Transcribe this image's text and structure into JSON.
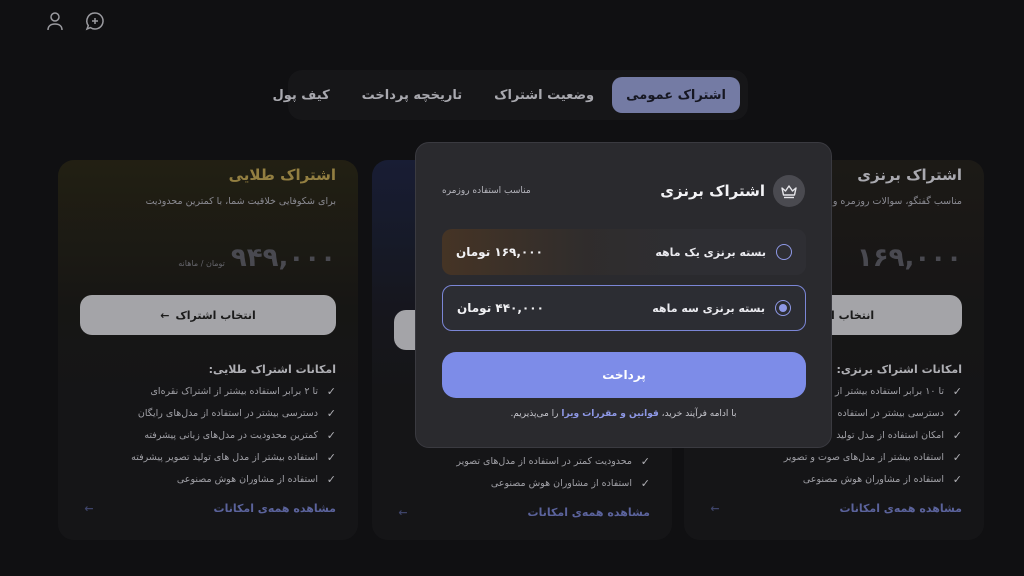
{
  "topbar": {
    "icons": [
      "user-icon",
      "chat-add-icon"
    ]
  },
  "tabs": [
    {
      "label": "اشتراک عمومی",
      "active": true
    },
    {
      "label": "وضعیت اشتراک",
      "active": false
    },
    {
      "label": "تاریخچه پرداخت",
      "active": false
    },
    {
      "label": "کیف پول",
      "active": false
    }
  ],
  "cards": {
    "gold": {
      "title": "اشتراک طلایی",
      "desc": "برای شکوفایی خلاقیت شما، با کمترین محدودیت",
      "price": "۹۴۹,۰۰۰",
      "price_unit": "تومان / ماهانه",
      "button": "انتخاب اشتراک",
      "features_title": "امکانات اشتراک طلایی:",
      "features": [
        "تا ۲ برابر استفاده بیشتر از اشتراک نقره‌ای",
        "دسترسی بیشتر در استفاده از مدل‌های رایگان",
        "کمترین محدودیت در مدل‌های زبانی پیشرفته",
        "استفاده بیشتر از مدل های تولید تصویر پیشرفته",
        "استفاده از مشاوران هوش مصنوعی"
      ],
      "see_all": "مشاهده همه‌ی امکانات"
    },
    "middle": {
      "features": [
        "محدودیت کمتر در استفاده از مدل‌های تصویر",
        "استفاده از مشاوران هوش مصنوعی"
      ],
      "see_all": "مشاهده همه‌ی امکانات"
    },
    "bronze": {
      "title": "اشتراک برنزی",
      "desc": "مناسب گفتگو، سوالات روزمره و",
      "price": "۱۶۹,۰۰۰",
      "button": "انتخاب اشتراک",
      "features_title": "امکانات اشتراک برنزی:",
      "features": [
        "تا ۱۰ برابر استفاده بیشتر از اشتراک",
        "دسترسی بیشتر در استفاده",
        "امکان استفاده از مدل تولید",
        "استفاده بیشتر از مدل‌های صوت و تصویر",
        "استفاده از مشاوران هوش مصنوعی"
      ],
      "see_all": "مشاهده همه‌ی امکانات"
    }
  },
  "modal": {
    "title": "اشتراک برنزی",
    "subtitle": "مناسب استفاده روزمره",
    "options": [
      {
        "label": "بسته برنزی یک ماهه",
        "price": "۱۶۹,۰۰۰ تومان",
        "selected": false
      },
      {
        "label": "بسته برنزی سه ماهه",
        "price": "۴۴۰,۰۰۰ تومان",
        "selected": true
      }
    ],
    "pay_button": "پرداخت",
    "terms_prefix": "با ادامه فرآیند خرید،",
    "terms_link": "قوانین و مقررات ویرا",
    "terms_suffix": "را می‌پذیریم."
  },
  "colors": {
    "accent": "#7d8ce8",
    "gold": "#b49c50",
    "active_tab": "#8e96c8"
  }
}
